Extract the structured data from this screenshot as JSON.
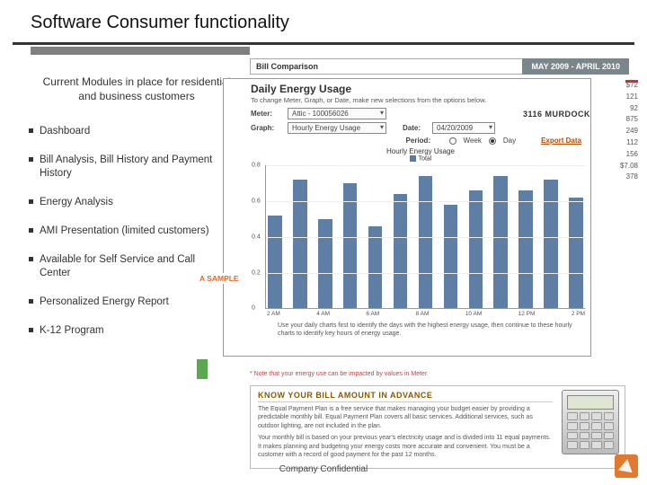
{
  "title": "Software Consumer functionality",
  "intro": "Current Modules in place for residential and business customers",
  "bullets": [
    "Dashboard",
    "Bill Analysis, Bill History and Payment History",
    "Energy Analysis",
    "AMI Presentation (limited customers)",
    "Available for Self Service and Call Center",
    "Personalized Energy Report",
    "K-12 Program"
  ],
  "bill_label": "Bill Comparison",
  "date_range": "MAY 2009 - APRIL 2010",
  "daily": {
    "title": "Daily Energy Usage",
    "sub": "To change Meter, Graph, or Date, make new selections from the options below.",
    "meter_label": "Meter:",
    "meter_value": "Attic - 100056026",
    "address": "3116 MURDOCK",
    "graph_label": "Graph:",
    "graph_value": "Hourly Energy Usage",
    "date_label": "Date:",
    "date_value": "04/20/2009",
    "period_label": "Period:",
    "week": "Week",
    "day": "Day",
    "export": "Export Data",
    "chart_title": "Hourly Energy Usage",
    "legend": "Total",
    "tip": "Use your daily charts first to identify the days with the highest energy usage, then continue to these hourly charts to identify key hours of energy usage."
  },
  "sample_label": "A SAMPLE",
  "red_note": "* Note that your energy use can be impacted by values in Meter.",
  "know": {
    "hdr": "KNOW YOUR BILL AMOUNT IN ADVANCE",
    "p1": "The Equal Payment Plan is a free service that makes managing your budget easier by providing a predictable monthly bill. Equal Payment Plan covers all basic services. Additional services, such as outdoor lighting, are not included in the plan.",
    "p2": "Your monthly bill is based on your previous year's electricity usage and is divided into 11 equal payments. It makes planning and budgeting your energy costs more accurate and convenient. You must be a customer with a record of good payment for the past 12 months."
  },
  "sidebar_values": [
    "$72",
    "121",
    "92",
    "875",
    "249",
    "112",
    "156",
    "$7.08",
    "378"
  ],
  "footer": "Company Confidential",
  "chart_data": {
    "type": "bar",
    "title": "Hourly Energy Usage",
    "legend": [
      "Total"
    ],
    "x": [
      "2 AM",
      "4 AM",
      "6 AM",
      "8 AM",
      "10 AM",
      "12 PM",
      "2 PM"
    ],
    "ylim": [
      0,
      0.8
    ],
    "yticks": [
      0,
      0.2,
      0.4,
      0.6,
      0.8
    ],
    "values": [
      0.52,
      0.72,
      0.5,
      0.7,
      0.46,
      0.64,
      0.74,
      0.58,
      0.66,
      0.74,
      0.66,
      0.72,
      0.62
    ]
  }
}
